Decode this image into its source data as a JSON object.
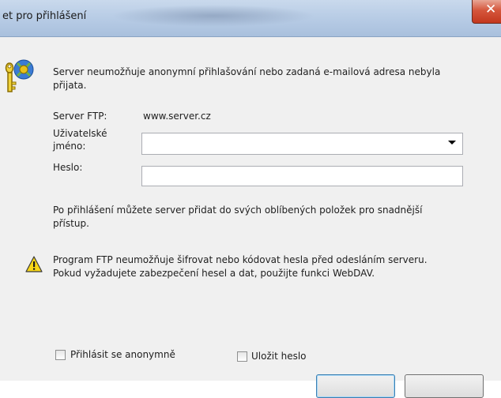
{
  "window": {
    "title": "et pro přihlášení",
    "close_glyph": "✕"
  },
  "message": {
    "line1": "Server neumožňuje anonymní přihlašování nebo zadaná e-mailová adresa nebyla",
    "line2": "přijata."
  },
  "form": {
    "server_label": "Server FTP:",
    "server_value": "www.server.cz",
    "username_label_line1": "Uživatelské",
    "username_label_line2": "jméno:",
    "username_value": "",
    "password_label": "Heslo:",
    "password_value": ""
  },
  "info": {
    "line1": "Po přihlášení můžete server přidat do svých oblíbených položek pro snadnější",
    "line2": "přístup."
  },
  "warning": {
    "line1": "Program FTP neumožňuje šifrovat nebo kódovat hesla před odesláním serveru.",
    "line2": "Pokud vyžadujete zabezpečení hesel a dat, použijte funkci WebDAV."
  },
  "options": {
    "anonymous_label": "Přihlásit se anonymně",
    "anonymous_checked": false,
    "save_password_label": "Uložit heslo",
    "save_password_checked": false
  },
  "icons": {
    "key": "key-icon",
    "warning": "warning-icon",
    "dropdown": "chevron-down-icon"
  }
}
